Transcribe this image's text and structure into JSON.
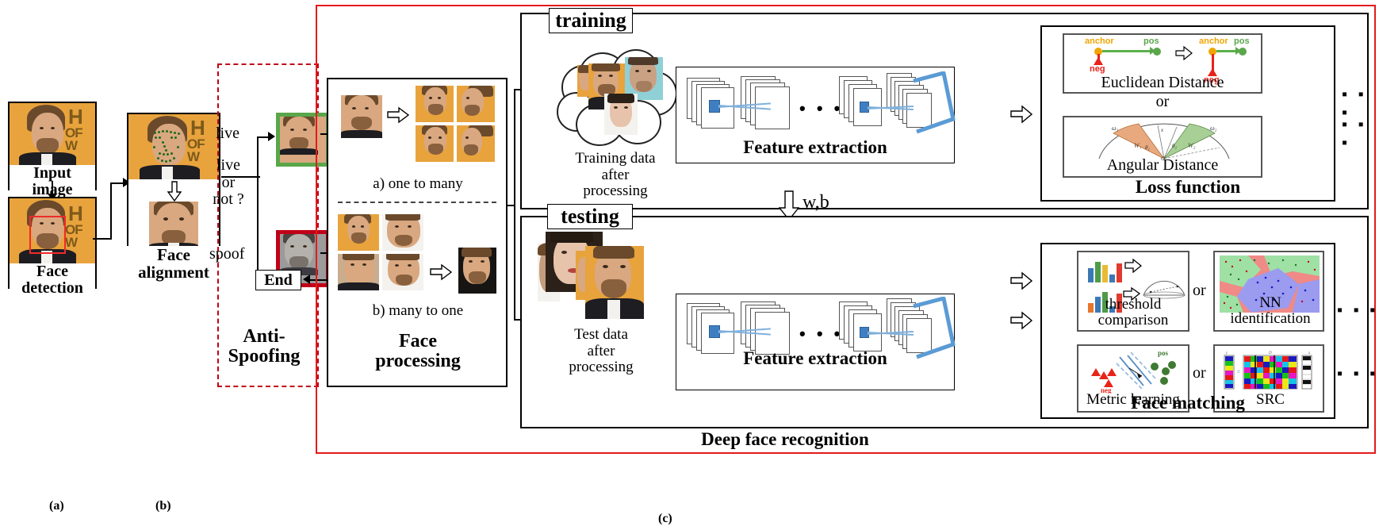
{
  "figure": {
    "caption_a": "(a)",
    "caption_b": "(b)",
    "caption_c": "(c)",
    "main_label": "Deep face recognition"
  },
  "colors": {
    "red_frame": "#e41a1c",
    "red_dash": "#c00018",
    "live_border": "#5aa64b",
    "spoof_border": "#c00018",
    "kernel_blue": "#3f7fc1",
    "connection_blue": "#7fb0dc",
    "pos_green": "#5aa64b",
    "neg_red": "#e8231a",
    "anchor_orange": "#f0a500"
  },
  "stage_a": {
    "input_image_label": "Input\nimage",
    "face_detection_label": "Face\ndetection",
    "poster_letters": "H\nOF W"
  },
  "stage_b": {
    "face_alignment_label": "Face\nalignment"
  },
  "anti_spoofing": {
    "title": "Anti-\nSpoofing",
    "branch_question": "live\nor\nnot ?",
    "live_label": "live",
    "spoof_label": "spoof",
    "end_label": "End"
  },
  "face_processing": {
    "title": "Face\nprocessing",
    "one_to_many_label": "a) one to many",
    "many_to_one_label": "b) many to one"
  },
  "training": {
    "tag": "training",
    "data_label": "Training data\nafter\nprocessing",
    "feature_extraction_label": "Feature extraction",
    "loss_function_label": "Loss function",
    "euclidean_label": "Euclidean Distance",
    "angular_label": "Angular Distance",
    "or_label": "or",
    "ellipsis": "▪ ▪ ▪",
    "triplet": {
      "anchor": "anchor",
      "pos": "pos",
      "neg": "neg"
    },
    "angular_symbols": {
      "w1": "ω₁",
      "w2": "ω₂",
      "theta1": "θ₁",
      "theta2": "θ₂",
      "x": "x",
      "W1": "W₁",
      "W2": "W₂",
      "origin": "O"
    }
  },
  "weights_arrow": {
    "label": "w,b"
  },
  "testing": {
    "tag": "testing",
    "data_label": "Test data\nafter\nprocessing",
    "feature_extraction_label": "Feature extraction",
    "face_matching_label": "Face matching",
    "threshold_label": "threshold\ncomparison",
    "nn_label": "NN\nidentification",
    "metric_label": "Metric learning",
    "src_label": "SRC",
    "or_label": "or",
    "ellipsis": "▪ ▪ ▪",
    "metric_pos": "pos",
    "metric_neg": "neg",
    "src_symbols": {
      "y": "y",
      "D": "D",
      "x": "x"
    }
  }
}
